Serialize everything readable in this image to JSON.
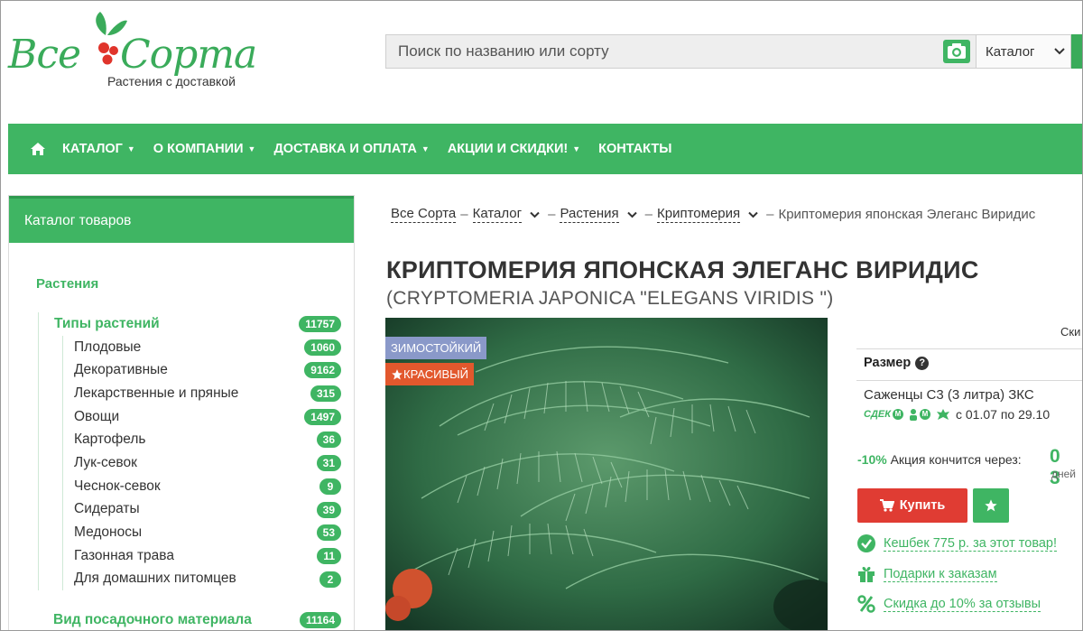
{
  "header": {
    "logo_left": "Все",
    "logo_right": "Сорта",
    "tagline": "Растения с доставкой",
    "search_placeholder": "Поиск по названию или сорту",
    "catalog_select": "Каталог"
  },
  "nav": {
    "items": [
      "КАТАЛОГ",
      "О КОМПАНИИ",
      "ДОСТАВКА И ОПЛАТА",
      "АКЦИИ И СКИДКИ!",
      "КОНТАКТЫ"
    ]
  },
  "sidebar": {
    "title": "Каталог товаров",
    "section": "Растения",
    "types": {
      "label": "Типы растений",
      "count": "11757"
    },
    "items": [
      {
        "label": "Плодовые",
        "count": "1060"
      },
      {
        "label": "Декоративные",
        "count": "9162"
      },
      {
        "label": "Лекарственные и пряные",
        "count": "315"
      },
      {
        "label": "Овощи",
        "count": "1497"
      },
      {
        "label": "Картофель",
        "count": "36"
      },
      {
        "label": "Лук-севок",
        "count": "31"
      },
      {
        "label": "Чеснок-севок",
        "count": "9"
      },
      {
        "label": "Сидераты",
        "count": "39"
      },
      {
        "label": "Медоносы",
        "count": "53"
      },
      {
        "label": "Газонная трава",
        "count": "11"
      },
      {
        "label": "Для домашних питомцев",
        "count": "2"
      }
    ],
    "material": {
      "label": "Вид посадочного материала",
      "count": "11164"
    }
  },
  "breadcrumb": {
    "home": "Все Сорта",
    "catalog": "Каталог",
    "plants": "Растения",
    "genus": "Криптомерия",
    "current": "Криптомерия японская Элеганс Виридис"
  },
  "product": {
    "title": "КРИПТОМЕРИЯ ЯПОНСКАЯ ЭЛЕГАНС ВИРИДИС",
    "latin": "(CRYPTOMERIA JAPONICA \"ELEGANS VIRIDIS \")",
    "tag_hardy": "ЗИМОСТОЙКИЙ",
    "tag_beautiful": "КРАСИВЫЙ"
  },
  "panel": {
    "top_text": "Ски",
    "size_label": "Размер",
    "size_value": "Саженцы С3 (3 литра) ЗКС",
    "cdek": "СДЕК",
    "delivery_dates": "с 01.07 по 29.10",
    "promo_pct": "-10%",
    "promo_text": "Акция кончится через:",
    "countdown": "0 3",
    "days": "дней",
    "buy": "Купить",
    "cashback": "Кешбек 775 р. за этот товар!",
    "gifts": "Подарки к заказам",
    "discount": "Скидка до 10% за отзывы"
  },
  "colors": {
    "brand_green": "#3fb563",
    "buy_red": "#e03c33",
    "tag_blue": "#8a99c9",
    "tag_orange": "#e2582d"
  }
}
